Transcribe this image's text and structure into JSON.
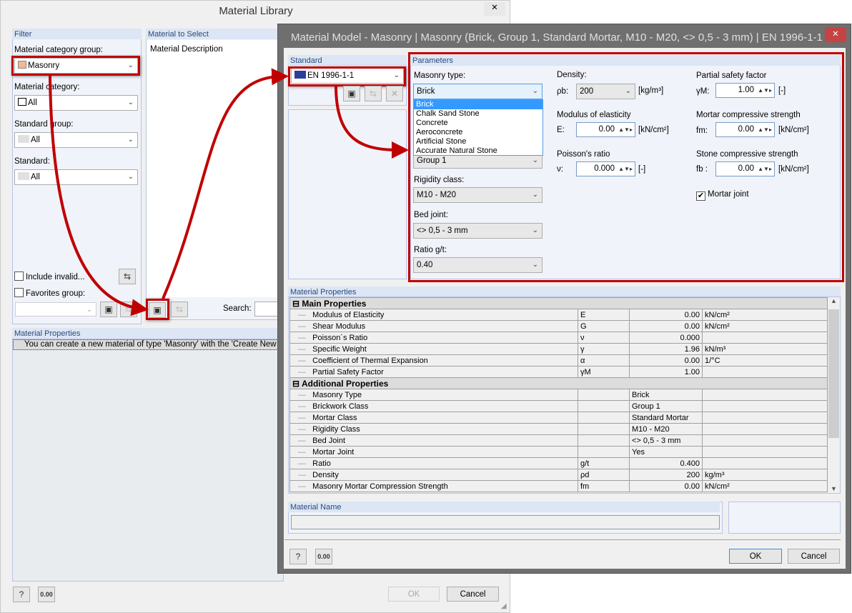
{
  "library": {
    "title": "Material Library",
    "filter_title": "Filter",
    "cat_group_label": "Material category group:",
    "cat_group_value": "Masonry",
    "cat_label": "Material category:",
    "cat_value": "All",
    "std_group_label": "Standard group:",
    "std_group_value": "All",
    "std_label": "Standard:",
    "std_value": "All",
    "include_invalid": "Include invalid...",
    "favorites": "Favorites group:",
    "select_title": "Material to Select",
    "col_desc": "Material Description",
    "search_label": "Search:",
    "props_title": "Material Properties",
    "props_message": "You can create a new material of type 'Masonry' with the 'Create New Maso",
    "ok": "OK",
    "cancel": "Cancel",
    "colors": {
      "masonry_swatch": "#f4b98f",
      "highlight": "#c00000"
    }
  },
  "model": {
    "title": "Material Model - Masonry | Masonry (Brick, Group 1, Standard Mortar, M10 - M20, <> 0,5 - 3 mm) | EN 1996-1-1",
    "standard_title": "Standard",
    "standard_value": "EN 1996-1-1",
    "params_title": "Parameters",
    "masonry_type_label": "Masonry type:",
    "masonry_type_value": "Brick",
    "masonry_type_options": [
      "Brick",
      "Chalk Sand Stone",
      "Concrete",
      "Aeroconcrete",
      "Artificial Stone",
      "Accurate Natural Stone"
    ],
    "group_value": "Group 1",
    "rigidity_label": "Rigidity class:",
    "rigidity_value": "M10 - M20",
    "bed_label": "Bed joint:",
    "bed_value": "<> 0,5 - 3 mm",
    "ratio_label": "Ratio g/t:",
    "ratio_value": "0.40",
    "density_label": "Density:",
    "density_sym": "ρb:",
    "density_value": "200",
    "density_unit": "[kg/m³]",
    "e_label": "Modulus of elasticity",
    "e_sym": "E:",
    "e_value": "0.00",
    "e_unit": "[kN/cm²]",
    "nu_label": "Poisson's ratio",
    "nu_sym": "ν:",
    "nu_value": "0.000",
    "nu_unit": "[-]",
    "psf_label": "Partial safety factor",
    "psf_sym": "γM:",
    "psf_value": "1.00",
    "psf_unit": "[-]",
    "fm_label": "Mortar compressive strength",
    "fm_sym": "fm:",
    "fm_value": "0.00",
    "fm_unit": "[kN/cm²]",
    "fb_label": "Stone compressive strength",
    "fb_sym": "fb :",
    "fb_value": "0.00",
    "fb_unit": "[kN/cm²]",
    "mortar_joint": "Mortar joint",
    "mortar_joint_checked": true,
    "props_title": "Material Properties",
    "groups": [
      {
        "name": "Main Properties",
        "rows": [
          [
            "Modulus of Elasticity",
            "E",
            "0.00",
            "kN/cm²"
          ],
          [
            "Shear Modulus",
            "G",
            "0.00",
            "kN/cm²"
          ],
          [
            "Poisson´s Ratio",
            "ν",
            "0.000",
            ""
          ],
          [
            "Specific Weight",
            "γ",
            "1.96",
            "kN/m³"
          ],
          [
            "Coefficient of Thermal Expansion",
            "α",
            "0.00",
            "1/°C"
          ],
          [
            "Partial Safety Factor",
            "γM",
            "1.00",
            ""
          ]
        ]
      },
      {
        "name": "Additional Properties",
        "rows": [
          [
            "Masonry Type",
            "",
            "Brick",
            ""
          ],
          [
            "Brickwork Class",
            "",
            "Group 1",
            ""
          ],
          [
            "Mortar Class",
            "",
            "Standard Mortar",
            ""
          ],
          [
            "Rigidity Class",
            "",
            "M10 - M20",
            ""
          ],
          [
            "Bed Joint",
            "",
            "<> 0,5 - 3 mm",
            ""
          ],
          [
            "Mortar Joint",
            "",
            "Yes",
            ""
          ],
          [
            "Ratio",
            "g/t",
            "0.400",
            ""
          ],
          [
            "Density",
            "ρd",
            "200",
            "kg/m³"
          ],
          [
            "Masonry Mortar Compression Strength",
            "fm",
            "0.00",
            "kN/cm²"
          ]
        ]
      }
    ],
    "name_title": "Material Name",
    "name_value": "",
    "ok": "OK",
    "cancel": "Cancel"
  }
}
